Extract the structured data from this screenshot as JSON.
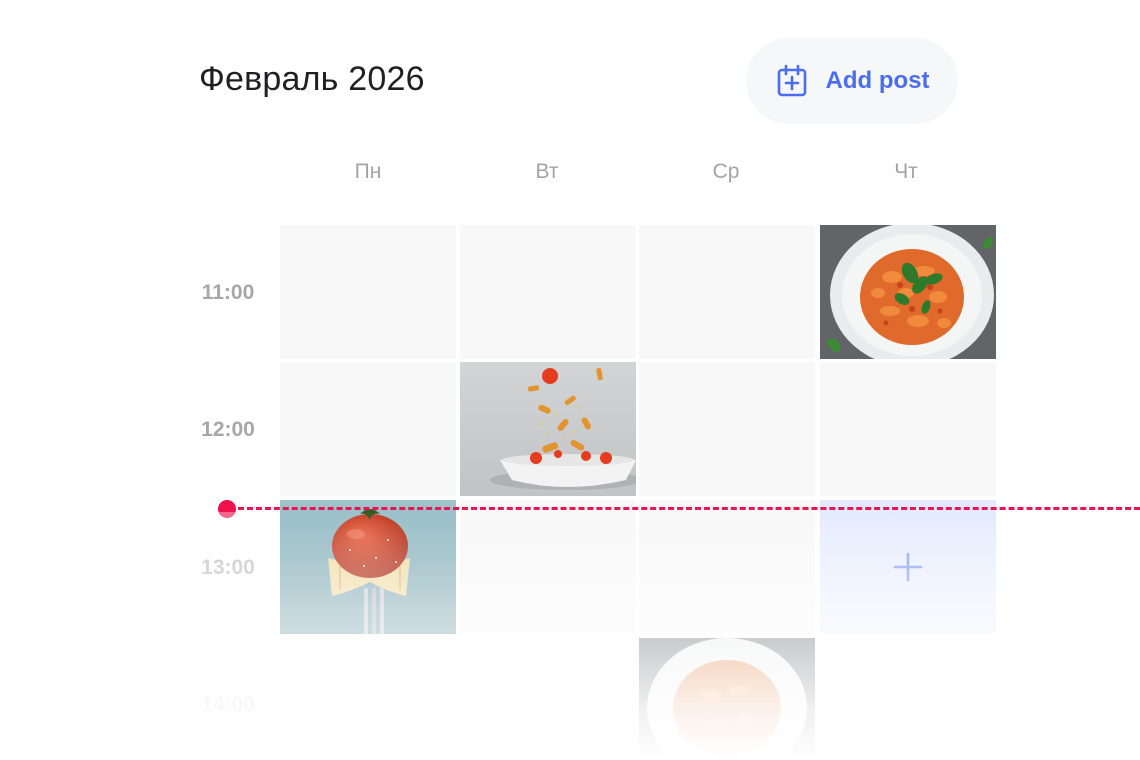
{
  "header": {
    "title": "Февраль 2026",
    "add_post_label": "Add post",
    "add_post_icon": "calendar-plus-icon"
  },
  "weekdays": [
    "Пн",
    "Вт",
    "Ср",
    "Чт"
  ],
  "times": [
    "11:00",
    "12:00",
    "13:00",
    "14:00"
  ],
  "posts": [
    {
      "day": "Чт",
      "time": "11:00",
      "image": "pasta-plate-basil"
    },
    {
      "day": "Вт",
      "time": "12:00",
      "image": "flying-pasta-bowl"
    },
    {
      "day": "Пн",
      "time": "13:00",
      "image": "tomato-on-farfalle-fork"
    },
    {
      "day": "Ср",
      "time": "14:00",
      "image": "pasta-plate"
    }
  ],
  "new_post_slot": {
    "day": "Чт",
    "time": "13:00",
    "icon": "plus-icon"
  },
  "colors": {
    "accent": "#4b6df2",
    "now_indicator": "#f0114c",
    "cell_bg": "#f8f8f8",
    "slot_highlight": "#e4eafe"
  }
}
